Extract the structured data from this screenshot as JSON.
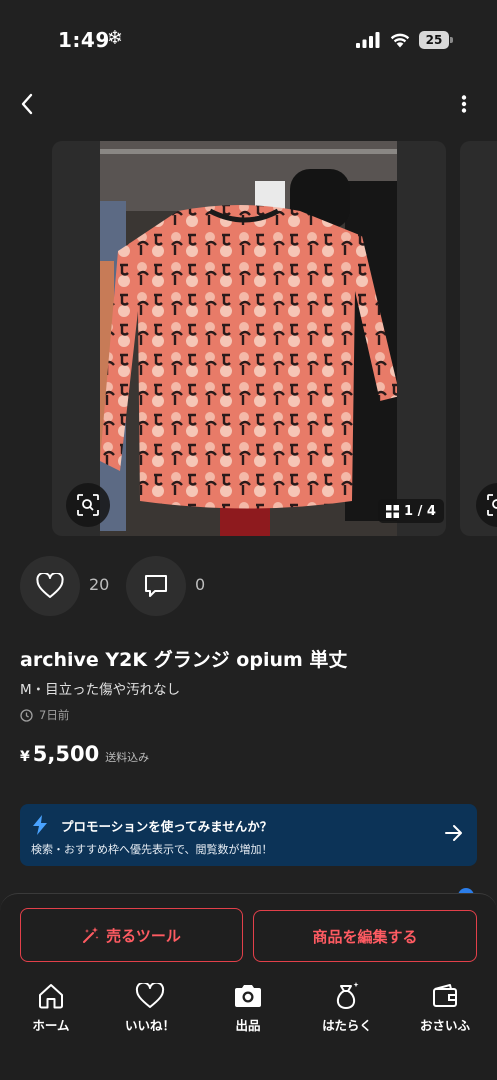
{
  "status_bar": {
    "time": "1:49",
    "battery": "25"
  },
  "gallery": {
    "counter": "1 / 4"
  },
  "actions": {
    "like_count": "20",
    "comment_count": "0"
  },
  "item": {
    "title": "archive Y2K グランジ opium 単丈",
    "description": "M・目立った傷や汚れなし",
    "posted": "7日前",
    "currency": "¥",
    "price": "5,500",
    "shipping": "送料込み"
  },
  "promo": {
    "title": "プロモーションを使ってみませんか？",
    "text": "検索・おすすめ枠へ優先表示で、閲覧数が増加！"
  },
  "buttons": {
    "sell_tools": "売るツール",
    "edit": "商品を編集する"
  },
  "tabbar": [
    {
      "label": "ホーム",
      "icon": "home-icon"
    },
    {
      "label": "いいね！",
      "icon": "heart-icon"
    },
    {
      "label": "出品",
      "icon": "camera-icon"
    },
    {
      "label": "はたらく",
      "icon": "money-bag-icon"
    },
    {
      "label": "おさいふ",
      "icon": "wallet-icon"
    }
  ],
  "colors": {
    "accent": "#ff5b62",
    "promo_bg": "#0c3357",
    "background": "#212121"
  }
}
